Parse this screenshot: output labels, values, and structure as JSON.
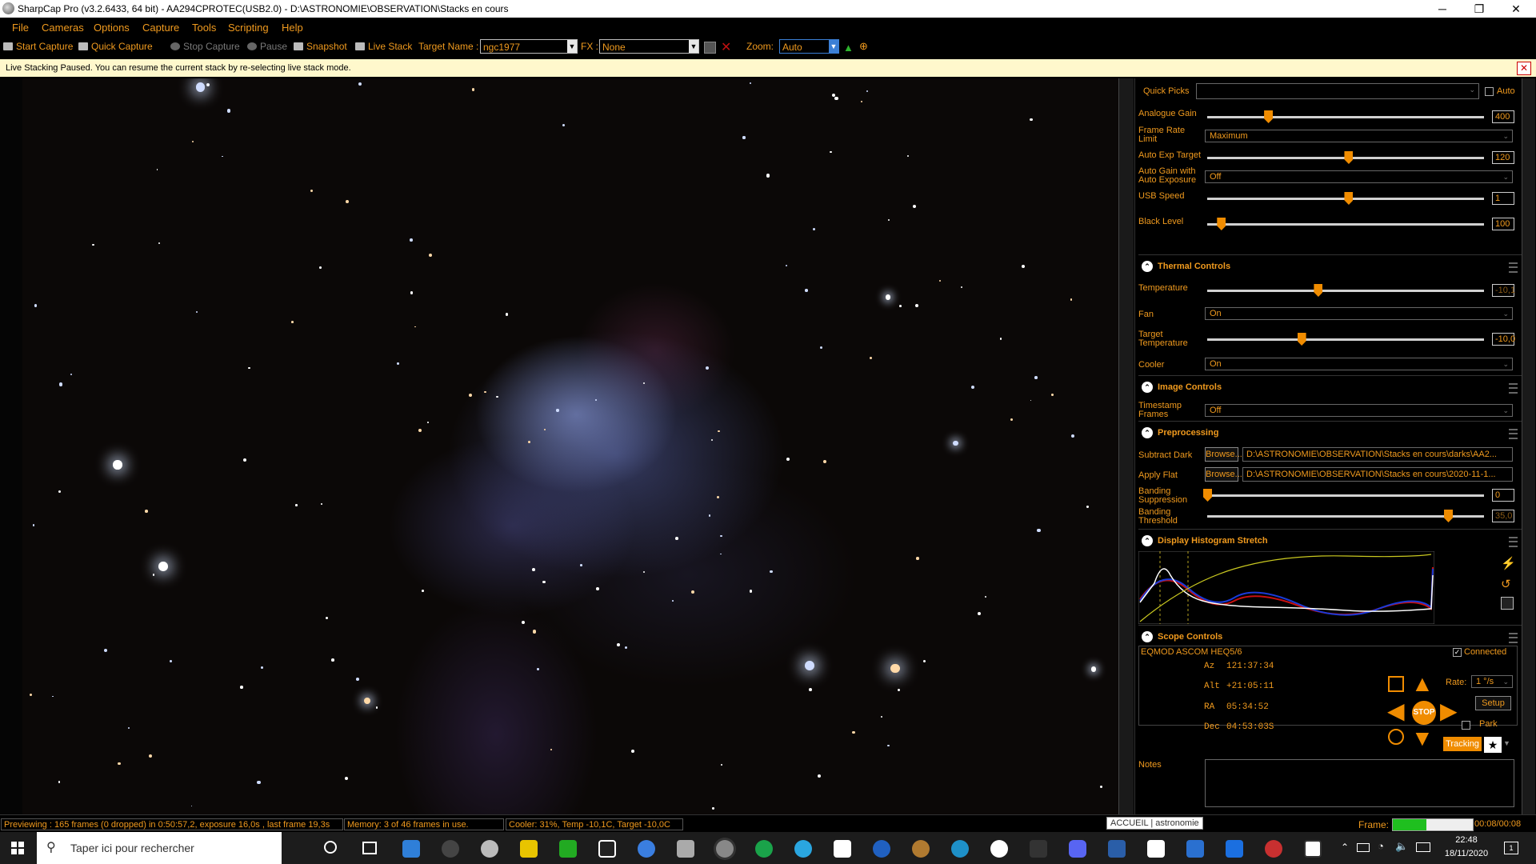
{
  "window": {
    "title": "SharpCap Pro (v3.2.6433, 64 bit) - AA294CPROTEC(USB2.0) - D:\\ASTRONOMIE\\OBSERVATION\\Stacks en cours",
    "minimize": "─",
    "maximize": "❐",
    "close": "✕"
  },
  "menu": [
    "File",
    "Cameras",
    "Options",
    "Capture",
    "Tools",
    "Scripting",
    "Help"
  ],
  "toolbar": {
    "start_capture": "Start Capture",
    "quick_capture": "Quick Capture",
    "stop_capture": "Stop Capture",
    "pause": "Pause",
    "snapshot": "Snapshot",
    "live_stack": "Live Stack",
    "target_name_label": "Target Name :",
    "target_name_value": "ngc1977",
    "fx_label": "FX :",
    "fx_value": "None",
    "zoom_label": "Zoom:",
    "zoom_value": "Auto"
  },
  "notification": {
    "text": "Live Stacking Paused. You can resume the current stack by re-selecting live stack mode.",
    "close": "✕"
  },
  "panel": {
    "quick_picks_label": "Quick Picks",
    "auto_label": "Auto",
    "camera_controls": {
      "analogue_gain": {
        "label": "Analogue Gain",
        "value": "400",
        "level": 0.22
      },
      "frame_rate_limit": {
        "label": "Frame Rate Limit",
        "value": "Maximum"
      },
      "auto_exp_target": {
        "label": "Auto Exp Target",
        "value": "120",
        "level": 0.51
      },
      "auto_gain_auto_exposure": {
        "label": "Auto Gain with Auto Exposure",
        "value": "Off"
      },
      "usb_speed": {
        "label": "USB Speed",
        "value": "1",
        "level": 0.51
      },
      "black_level": {
        "label": "Black Level",
        "value": "100",
        "level": 0.05
      }
    },
    "thermal": {
      "title": "Thermal Controls",
      "temperature": {
        "label": "Temperature",
        "value": "-10,1",
        "level": 0.4
      },
      "fan": {
        "label": "Fan",
        "value": "On"
      },
      "target_temperature": {
        "label": "Target Temperature",
        "value": "-10,0",
        "level": 0.34
      },
      "cooler": {
        "label": "Cooler",
        "value": "On"
      }
    },
    "image": {
      "title": "Image Controls",
      "timestamp_frames": {
        "label": "Timestamp Frames",
        "value": "Off"
      }
    },
    "preprocessing": {
      "title": "Preprocessing",
      "subtract_dark": {
        "label": "Subtract Dark",
        "button": "Browse...",
        "path": "D:\\ASTRONOMIE\\OBSERVATION\\Stacks en cours\\darks\\AA2..."
      },
      "apply_flat": {
        "label": "Apply Flat",
        "button": "Browse...",
        "path": "D:\\ASTRONOMIE\\OBSERVATION\\Stacks en cours\\2020-11-1..."
      },
      "banding_suppression": {
        "label": "Banding Suppression",
        "value": "0",
        "level": 0.0
      },
      "banding_threshold": {
        "label": "Banding Threshold",
        "value": "35,0",
        "level": 0.87
      }
    },
    "histogram": {
      "title": "Display Histogram Stretch"
    },
    "scope": {
      "title": "Scope Controls",
      "mount": "EQMOD ASCOM HEQ5/6",
      "connected_label": "Connected",
      "az": {
        "label": "Az",
        "value": "121:37:34"
      },
      "alt": {
        "label": "Alt",
        "value": "+21:05:11"
      },
      "ra": {
        "label": "RA",
        "value": "05:34:52"
      },
      "dec": {
        "label": "Dec",
        "value": "04:53:03S"
      },
      "rate_label": "Rate:",
      "rate_value": "1 °/s",
      "setup": "Setup",
      "park": "Park",
      "tracking": "Tracking",
      "stop": "STOP"
    },
    "notes_label": "Notes"
  },
  "status": {
    "previewing": "Previewing : 165 frames (0 dropped) in 0:50:57,2, exposure 16,0s , last frame 19,3s",
    "memory": "Memory: 3 of 46 frames in use.",
    "cooler": "Cooler: 31%, Temp -10,1C, Target -10,0C",
    "frame_label": "Frame:",
    "frame_time": "00:08/00:08",
    "frame_progress": 0.42
  },
  "taskbar": {
    "search_placeholder": "Taper ici pour rechercher",
    "tooltip": "ACCUEIL | astronomie",
    "time": "22:48",
    "date": "18/11/2020",
    "notification_count": "1"
  },
  "colors": {
    "accent": "#f09a1e",
    "slider_thumb": "#f08c00",
    "notification_bg": "#fff8cc",
    "frame_bar": "#1fbf1f"
  }
}
